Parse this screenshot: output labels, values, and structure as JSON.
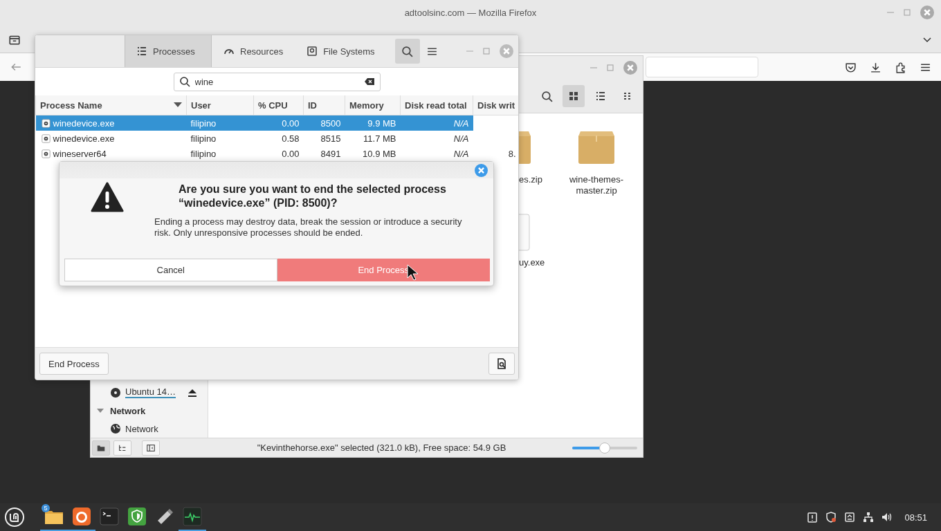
{
  "browser": {
    "title": "adtoolsinc.com — Mozilla Firefox"
  },
  "file_manager": {
    "view_buttons": [
      {
        "kind": "icons",
        "selected": true
      },
      {
        "kind": "list",
        "selected": false
      },
      {
        "kind": "compact",
        "selected": false
      }
    ],
    "files": [
      {
        "name": "es.zip",
        "kind": "archive"
      },
      {
        "name": "wine-themes-master.zip",
        "kind": "archive"
      },
      {
        "name": "uy.exe",
        "kind": "program"
      }
    ],
    "sidebar": [
      {
        "kind": "device",
        "label": "Ubuntu 14…"
      },
      {
        "kind": "heading",
        "label": "Network",
        "expanded": true
      },
      {
        "kind": "place",
        "label": "Network"
      }
    ],
    "pane_buttons": [
      {
        "kind": "places",
        "selected": true
      },
      {
        "kind": "tree",
        "selected": false
      },
      {
        "kind": "toggle",
        "selected": false
      }
    ],
    "status": "\"Kevinthehorse.exe\" selected (321.0 kB), Free space: 54.9 GB",
    "zoom": {
      "level": 0.5
    }
  },
  "system_monitor": {
    "tabs": [
      {
        "label": "Processes",
        "kind": "processes",
        "selected": true
      },
      {
        "label": "Resources",
        "kind": "resources",
        "selected": false
      },
      {
        "label": "File Systems",
        "kind": "filesystems",
        "selected": false
      }
    ],
    "search_active": true,
    "search": {
      "value": "wine"
    },
    "columns": [
      "Process Name",
      "User",
      "% CPU",
      "ID",
      "Memory",
      "Disk read total",
      "Disk writ"
    ],
    "rows": [
      {
        "selected": true,
        "cells": [
          "winedevice.exe",
          "filipino",
          "0.00",
          "8500",
          "9.9 MB",
          "N/A"
        ]
      },
      {
        "selected": false,
        "cells": [
          "winedevice.exe",
          "filipino",
          "0.58",
          "8515",
          "11.7 MB",
          "N/A"
        ]
      },
      {
        "selected": false,
        "cells": [
          "wineserver64",
          "filipino",
          "0.00",
          "8491",
          "10.9 MB",
          "N/A",
          "8."
        ]
      }
    ],
    "end_button": "End Process"
  },
  "dialog": {
    "title": "Are you sure you want to end the selected process “winedevice.exe” (PID: 8500)?",
    "message": "Ending a process may destroy data, break the session or introduce a security risk. Only unresponsive processes should be ended.",
    "buttons": [
      {
        "label": "Cancel",
        "kind": "cancel"
      },
      {
        "label": "End Process",
        "kind": "destructive"
      }
    ]
  },
  "taskbar": {
    "apps": [
      {
        "kind": "files",
        "badge": "5",
        "running": true
      },
      {
        "kind": "firefox",
        "running": true
      },
      {
        "kind": "terminal",
        "running": false
      },
      {
        "kind": "shield",
        "running": false
      },
      {
        "kind": "usb",
        "running": false
      },
      {
        "kind": "monitor",
        "running": true
      }
    ],
    "clock": "08:51"
  }
}
